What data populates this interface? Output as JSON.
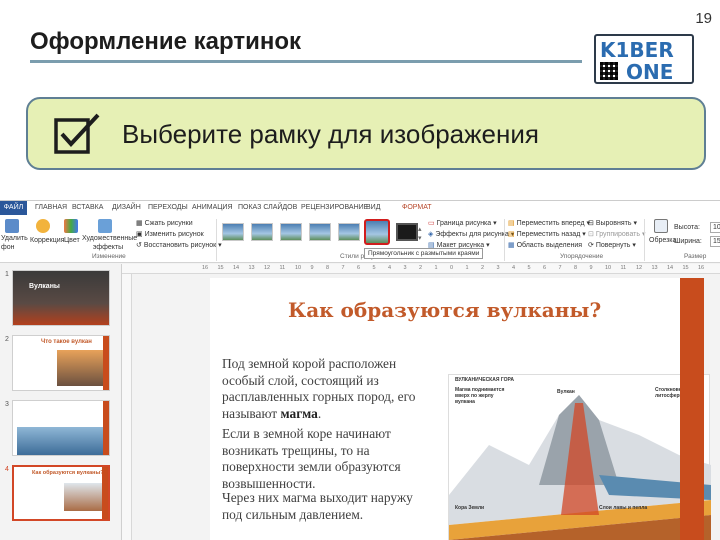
{
  "page": {
    "title": "Оформление картинок",
    "number": "19",
    "instruction": "Выберите рамку для изображения"
  },
  "logo": {
    "line1": "K1BER",
    "line2": "ONE"
  },
  "ppt": {
    "tabs": [
      "ФАЙЛ",
      "ГЛАВНАЯ",
      "ВСТАВКА",
      "ДИЗАЙН",
      "ПЕРЕХОДЫ",
      "АНИМАЦИЯ",
      "ПОКАЗ СЛАЙДОВ",
      "РЕЦЕНЗИРОВАНИЕ",
      "ВИД",
      "ФОРМАТ"
    ],
    "ribbon": {
      "remove_bg": "Удалить фон",
      "corrections": "Коррекция",
      "color": "Цвет",
      "artistic": "Художественные эффекты",
      "compress": "Сжать рисунки",
      "change": "Изменить рисунок",
      "reset": "Восстановить рисунок",
      "group_change": "Изменение",
      "group_styles": "Стили рисунков",
      "border": "Граница рисунка",
      "effects": "Эффекты для рисунка",
      "layout": "Макет рисунка",
      "bring_forward": "Переместить вперед",
      "send_backward": "Переместить назад",
      "selection_pane": "Область выделения",
      "align": "Выровнять",
      "group": "Группировать",
      "rotate": "Повернуть",
      "group_arrange": "Упорядочение",
      "crop": "Обрезка",
      "height_label": "Высота:",
      "height_value": "10",
      "width_label": "Ширина:",
      "width_value": "15",
      "group_size": "Размер",
      "tooltip": "Прямоугольник с размытыми краями"
    },
    "ruler_ticks": [
      "16",
      "15",
      "14",
      "13",
      "12",
      "11",
      "10",
      "9",
      "8",
      "7",
      "6",
      "5",
      "4",
      "3",
      "2",
      "1",
      "0",
      "1",
      "2",
      "3",
      "4",
      "5",
      "6",
      "7",
      "8",
      "9",
      "10",
      "11",
      "12",
      "13",
      "14",
      "15",
      "16"
    ],
    "thumbnails": [
      {
        "num": "1",
        "title": "Вулканы"
      },
      {
        "num": "2",
        "title": "Что такое вулкан"
      },
      {
        "num": "3",
        "title": ""
      },
      {
        "num": "4",
        "title": "Как образуются вулканы?"
      }
    ],
    "slide": {
      "heading": "Как образуются вулканы?",
      "p1_before": "Под земной корой расположен особый слой, состоящий из расплавленных горных пород, его называют ",
      "p1_bold": "магма",
      "p1_after": ".",
      "p2": "Если в земной коре начинают возникать трещины, то на поверхности земли образуются возвышенности.",
      "p3": "Через них магма выходит наружу под сильным давлением.",
      "diagram": {
        "title": "ВУЛКАНИЧЕСКАЯ ГОРА",
        "magma": "Магма поднимается вверх по жерлу вулкана",
        "volcano": "Вулкан",
        "plates": "Столкновение двух литосферных плит",
        "crust": "Кора Земли",
        "ash": "Слои лавы и пепла"
      }
    }
  },
  "colors": {
    "accent": "#c84c1d",
    "banner_bg": "#e6f0b5",
    "title_line": "#7b9dae",
    "file_tab": "#2b579a"
  }
}
